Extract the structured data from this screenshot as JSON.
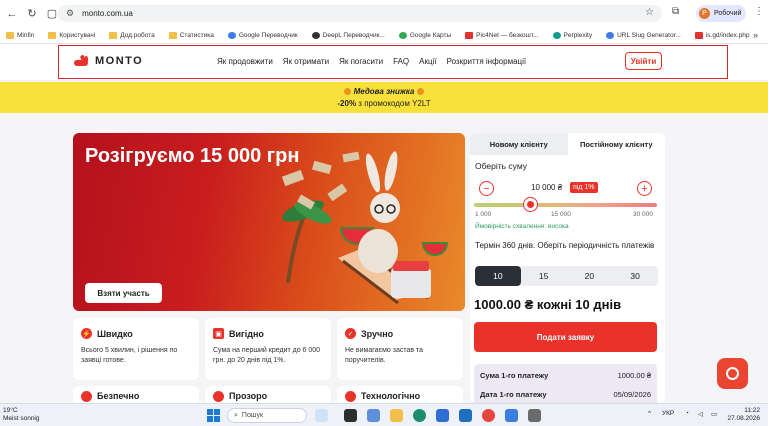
{
  "browser": {
    "url": "monto.com.ua",
    "profile_initial": "Р",
    "profile_name": "Робочий",
    "bookmarks": [
      "Minfin",
      "Користувачі",
      "Дод.робота",
      "Статистика",
      "Google Переводчик",
      "DeepL Переводчик...",
      "Google Карты",
      "Pic4Net — безкошт...",
      "Perplexity",
      "URL Slug Generator...",
      "is.gd/index.php"
    ]
  },
  "header": {
    "logo": "MONTO",
    "nav": [
      "Як продовжити",
      "Як отримати",
      "Як погасити",
      "FAQ",
      "Акції",
      "Розкриття інформації"
    ],
    "login": "Увійти"
  },
  "promo": {
    "line1": "Медова знижка",
    "line2_bold": "-20%",
    "line2_rest": " з промокодом Y2LT"
  },
  "hero": {
    "title": "Розігруємо 15 000 грн",
    "cta": "Взяти участь"
  },
  "features": [
    {
      "icon": "lightning-icon",
      "title": "Швидко",
      "text": "Всього 5 хвилин, і рішення по заявці готове."
    },
    {
      "icon": "wallet-icon",
      "title": "Вигідно",
      "text": "Сума на перший кредит до 6 000 грн. до 20 днів під 1%."
    },
    {
      "icon": "check-icon",
      "title": "Зручно",
      "text": "Не вимагаємо застав та поручителів."
    }
  ],
  "features_row2": [
    "Безпечно",
    "Прозоро",
    "Технологічно"
  ],
  "calculator": {
    "tab_new": "Новому клієнту",
    "tab_returning": "Постійному клієнту",
    "choose_sum": "Оберіть суму",
    "amount": "10 000 ₴",
    "rate_badge": "під 1%",
    "slider_min": "1 000",
    "slider_mid": "15 000",
    "slider_max": "30 000",
    "slider_fraction": 0.31,
    "approval": "Ймовірність схвалення: висока",
    "term_label": "Термін 360 днів. Оберіть періодичність платежів",
    "terms": [
      "10",
      "15",
      "20",
      "30"
    ],
    "selected_term": "10",
    "summary": "1000.00 ₴ кожні 10 днів",
    "apply": "Подати заявку",
    "rows": [
      {
        "label": "Сума 1-го платежу",
        "value": "1000.00 ₴"
      },
      {
        "label": "Дата 1-го платежу",
        "value": "05/09/2026"
      }
    ]
  },
  "taskbar": {
    "temp": "19°C",
    "weather": "Meist sonnig",
    "search": "Пошук",
    "lang": "УКР",
    "time": "11:22",
    "date": "27.08.2026"
  },
  "colors": {
    "accent": "#e8322a",
    "promo_bg": "#f8e13a",
    "active_term": "#2b2f38"
  }
}
